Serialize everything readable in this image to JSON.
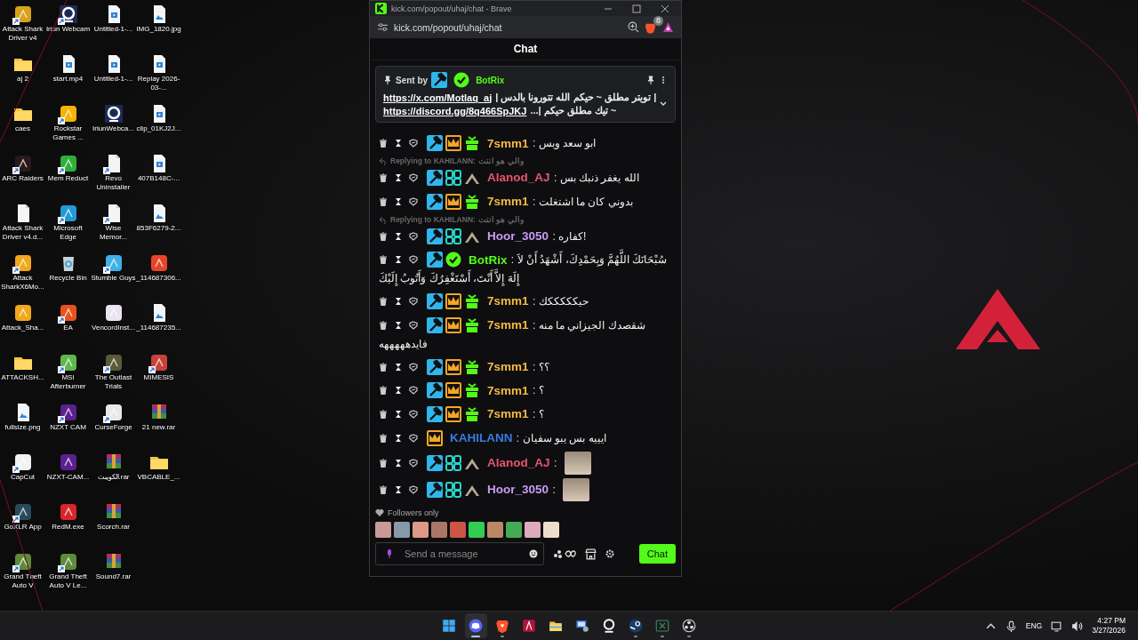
{
  "desktop": {
    "rows": [
      [
        {
          "label": "Attack Shark Driver v4",
          "kind": "app",
          "color": "#d9a21b",
          "shortcut": true
        },
        {
          "label": "Iriun Webcam",
          "kind": "webcam",
          "color": "#1b2b55",
          "shortcut": true
        },
        {
          "label": "Untitled-1-...",
          "kind": "video",
          "shortcut": false
        },
        {
          "label": "IMG_1820.jpg",
          "kind": "image",
          "shortcut": false
        }
      ],
      [
        {
          "label": "aj 2",
          "kind": "folder",
          "shortcut": false
        },
        {
          "label": "start.mp4",
          "kind": "video",
          "shortcut": false
        },
        {
          "label": "Untitled-1-...",
          "kind": "video",
          "shortcut": false
        },
        {
          "label": "Replay 2026-03-...",
          "kind": "video",
          "shortcut": false
        }
      ],
      [
        {
          "label": "caes",
          "kind": "folder",
          "shortcut": false
        },
        {
          "label": "Rockstar Games ...",
          "kind": "app",
          "color": "#f5b400",
          "shortcut": true
        },
        {
          "label": "IriunWebca...",
          "kind": "webcam",
          "color": "#1b2b55",
          "shortcut": false
        },
        {
          "label": "clip_01KJ2J...",
          "kind": "video",
          "shortcut": false
        }
      ],
      [
        {
          "label": "ARC Raiders",
          "kind": "app",
          "color": "#2a1a1a",
          "shortcut": true
        },
        {
          "label": "Mem Reduct",
          "kind": "app",
          "color": "#2fae3a",
          "shortcut": true
        },
        {
          "label": "Revo Uninstaller",
          "kind": "file",
          "shortcut": true
        },
        {
          "label": "407B148C-...",
          "kind": "video",
          "shortcut": false
        }
      ],
      [
        {
          "label": "Attack Shark Driver v4.d...",
          "kind": "file",
          "shortcut": false
        },
        {
          "label": "Microsoft Edge",
          "kind": "app",
          "color": "#1e9bd7",
          "shortcut": true
        },
        {
          "label": "Wise Memor...",
          "kind": "file",
          "shortcut": true
        },
        {
          "label": "853F6279-2...",
          "kind": "image",
          "shortcut": false
        }
      ],
      [
        {
          "label": "Attack SharkX6Mo...",
          "kind": "app",
          "color": "#f0a81c",
          "shortcut": true
        },
        {
          "label": "Recycle Bin",
          "kind": "bin",
          "shortcut": false
        },
        {
          "label": "Stumble Guys",
          "kind": "app",
          "color": "#3fb1e8",
          "shortcut": true
        },
        {
          "label": "_114687306...",
          "kind": "app",
          "color": "#e8442a",
          "shortcut": false
        }
      ],
      [
        {
          "label": "Attack_Sha...",
          "kind": "app",
          "color": "#f0a81c",
          "shortcut": false
        },
        {
          "label": "EA",
          "kind": "app",
          "color": "#e8521e",
          "shortcut": true
        },
        {
          "label": "VencordInst...",
          "kind": "app",
          "color": "#e9e4f0",
          "shortcut": false
        },
        {
          "label": "_114687235...",
          "kind": "image",
          "shortcut": false
        }
      ],
      [
        {
          "label": "ATTACKSH...",
          "kind": "folder",
          "shortcut": false
        },
        {
          "label": "MSI Afterburner",
          "kind": "app",
          "color": "#5fb84a",
          "shortcut": true
        },
        {
          "label": "The Outlast Trials",
          "kind": "app",
          "color": "#5a5a3a",
          "shortcut": true
        },
        {
          "label": "MIMESIS",
          "kind": "app",
          "color": "#c9413a",
          "shortcut": true
        }
      ],
      [
        {
          "label": "fullsize.png",
          "kind": "image",
          "shortcut": false
        },
        {
          "label": "NZXT CAM",
          "kind": "app",
          "color": "#5b1f8f",
          "shortcut": true
        },
        {
          "label": "CurseForge",
          "kind": "app",
          "color": "#e8e8e8",
          "shortcut": true
        },
        {
          "label": "21 new.rar",
          "kind": "archive",
          "shortcut": false
        }
      ],
      [
        {
          "label": "CapCut",
          "kind": "app",
          "color": "#f2f2f2",
          "shortcut": true
        },
        {
          "label": "NZXT-CAM...",
          "kind": "app",
          "color": "#5b1f8f",
          "shortcut": false
        },
        {
          "label": "الكويبت.rar",
          "kind": "archive",
          "shortcut": false
        },
        {
          "label": "VBCABLE_...",
          "kind": "folder",
          "shortcut": false
        }
      ],
      [
        {
          "label": "GoXLR App",
          "kind": "app",
          "color": "#2a4a5a",
          "shortcut": true
        },
        {
          "label": "RedM.exe",
          "kind": "app",
          "color": "#d8262c",
          "shortcut": false
        },
        {
          "label": "Scorch.rar",
          "kind": "archive",
          "shortcut": false
        }
      ],
      [
        {
          "label": "Grand Theft Auto V",
          "kind": "app",
          "color": "#5f8a3a",
          "shortcut": true
        },
        {
          "label": "Grand Theft Auto V Le...",
          "kind": "app",
          "color": "#5f8a3a",
          "shortcut": true
        },
        {
          "label": "Sound7.rar",
          "kind": "archive",
          "shortcut": false
        }
      ]
    ]
  },
  "browser": {
    "title": "kick.com/popout/uhaj/chat - Brave",
    "url": "kick.com/popout/uhaj/chat",
    "shield_count": "8"
  },
  "chat": {
    "header": "Chat",
    "pinned": {
      "sent_by": "Sent by",
      "user": "BotRix",
      "badges": [
        {
          "kind": "mod"
        },
        {
          "kind": "verified"
        }
      ],
      "lines": [
        {
          "link": "https://x.com/Motlaq_aj",
          "text": "| تويتر مطلق ~ حيكم الله تتورونا بالدس |"
        },
        {
          "link": "https://discord.gg/8q466SpJKJ",
          "text": "~ تيك مطلق حيكم |..."
        }
      ]
    },
    "messages": [
      {
        "user": "7smm1",
        "color": "#f5b942",
        "badges": [
          {
            "kind": "mod"
          },
          {
            "kind": "sub"
          },
          {
            "kind": "gift"
          }
        ],
        "text": ": ابو سعد وبس"
      },
      {
        "reply": "Replying to KAHILANN:",
        "reply_text": "والي هو انتت",
        "user": "Alanod_AJ",
        "color": "#e8546e",
        "badges": [
          {
            "kind": "mod"
          },
          {
            "kind": "og"
          },
          {
            "kind": "rank"
          }
        ],
        "text": ": الله يغفر ذنبك بس"
      },
      {
        "user": "7smm1",
        "color": "#f5b942",
        "badges": [
          {
            "kind": "mod"
          },
          {
            "kind": "sub"
          },
          {
            "kind": "gift"
          }
        ],
        "text": ": بدوني كان ما اشتغلت"
      },
      {
        "reply": "Replying to KAHILANN:",
        "reply_text": "والي هو انتت",
        "user": "Hoor_3050",
        "color": "#c89cf5",
        "badges": [
          {
            "kind": "mod"
          },
          {
            "kind": "og"
          },
          {
            "kind": "rank"
          }
        ],
        "text": ": كفاره!"
      },
      {
        "user": "BotRix",
        "color": "#53fc18",
        "badges": [
          {
            "kind": "mod"
          },
          {
            "kind": "verified"
          }
        ],
        "text": ": سُبْحَانَكَ اللَّهُمَّ وَبِحَمْدِكَ، أَشْهَدُ أَنْ لاَ",
        "text_cont": "إِلَهَ إِلاَّ أَنْتَ، أَسْتَغْفِرُكَ وَأَتُوبُ إِلَيْكَ"
      },
      {
        "user": "7smm1",
        "color": "#f5b942",
        "badges": [
          {
            "kind": "mod"
          },
          {
            "kind": "sub"
          },
          {
            "kind": "gift"
          }
        ],
        "text": ": حيكككككك"
      },
      {
        "user": "7smm1",
        "color": "#f5b942",
        "badges": [
          {
            "kind": "mod"
          },
          {
            "kind": "sub"
          },
          {
            "kind": "gift"
          }
        ],
        "text": ": شقصدك الجيزاني ما منه",
        "text_cont": "فايدهههههه"
      },
      {
        "user": "7smm1",
        "color": "#f5b942",
        "badges": [
          {
            "kind": "mod"
          },
          {
            "kind": "sub"
          },
          {
            "kind": "gift"
          }
        ],
        "text": ": ؟؟"
      },
      {
        "user": "7smm1",
        "color": "#f5b942",
        "badges": [
          {
            "kind": "mod"
          },
          {
            "kind": "sub"
          },
          {
            "kind": "gift"
          }
        ],
        "text": ": ؟"
      },
      {
        "user": "7smm1",
        "color": "#f5b942",
        "badges": [
          {
            "kind": "mod"
          },
          {
            "kind": "sub"
          },
          {
            "kind": "gift"
          }
        ],
        "text": ": ؟"
      },
      {
        "user": "KAHILANN",
        "color": "#3a7be0",
        "badges": [
          {
            "kind": "sub"
          }
        ],
        "text": ": ايييه بس يبو سفيان"
      },
      {
        "user": "Alanod_AJ",
        "color": "#e8546e",
        "badges": [
          {
            "kind": "mod"
          },
          {
            "kind": "og"
          },
          {
            "kind": "rank"
          }
        ],
        "text": ":",
        "emote": true
      },
      {
        "user": "Hoor_3050",
        "color": "#c89cf5",
        "badges": [
          {
            "kind": "mod"
          },
          {
            "kind": "og"
          },
          {
            "kind": "rank"
          }
        ],
        "text": ":",
        "emote": true
      }
    ],
    "followers_only": "Followers only",
    "input": {
      "placeholder": "Send a message"
    },
    "send_button": "Chat"
  },
  "taskbar": {
    "apps": [
      {
        "kind": "start",
        "running": false,
        "selected": false
      },
      {
        "kind": "discord",
        "running": true,
        "selected": true
      },
      {
        "kind": "brave",
        "running": true,
        "selected": false
      },
      {
        "kind": "red-app",
        "running": false,
        "selected": false
      },
      {
        "kind": "files",
        "running": false,
        "selected": false
      },
      {
        "kind": "monitor",
        "running": false,
        "selected": false
      },
      {
        "kind": "webcam",
        "running": false,
        "selected": false
      },
      {
        "kind": "steam",
        "running": true,
        "selected": false
      },
      {
        "kind": "xbox",
        "running": true,
        "selected": false
      },
      {
        "kind": "obs",
        "running": true,
        "selected": false
      }
    ],
    "language": "ENG",
    "time": "4:27 PM",
    "date": "3/27/2026"
  }
}
